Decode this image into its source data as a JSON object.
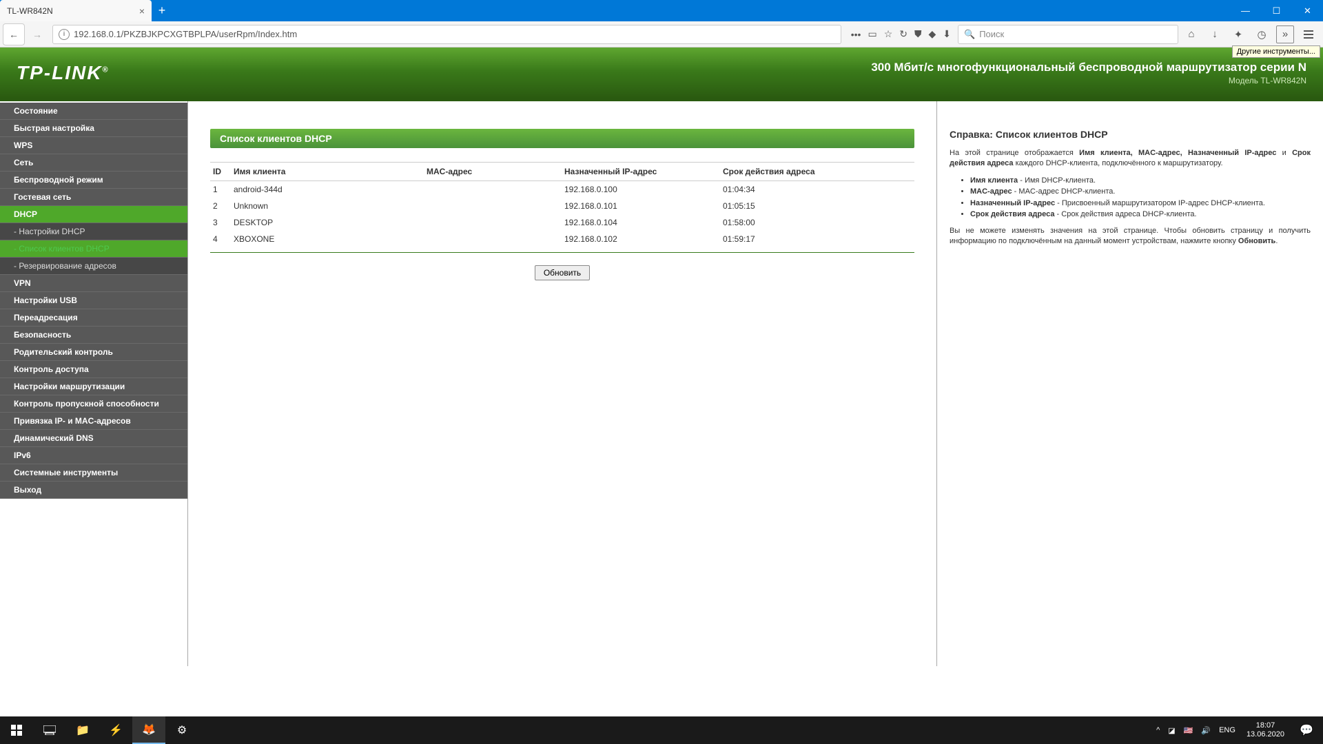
{
  "browser": {
    "tab_title": "TL-WR842N",
    "url": "192.168.0.1/PKZBJKPCXGTBPLPA/userRpm/Index.htm",
    "search_placeholder": "Поиск",
    "tooltip": "Другие инструменты..."
  },
  "router_header": {
    "logo": "TP-LINK",
    "title": "300 Мбит/с многофункциональный беспроводной маршрутизатор серии N",
    "model": "Модель TL-WR842N"
  },
  "sidebar": {
    "items": [
      {
        "label": "Состояние",
        "type": "main"
      },
      {
        "label": "Быстрая настройка",
        "type": "main"
      },
      {
        "label": "WPS",
        "type": "main"
      },
      {
        "label": "Сеть",
        "type": "main"
      },
      {
        "label": "Беспроводной режим",
        "type": "main"
      },
      {
        "label": "Гостевая сеть",
        "type": "main"
      },
      {
        "label": "DHCP",
        "type": "main",
        "active": true
      },
      {
        "label": "- Настройки DHCP",
        "type": "sub"
      },
      {
        "label": "- Список клиентов DHCP",
        "type": "sub",
        "active": true
      },
      {
        "label": "- Резервирование адресов",
        "type": "sub"
      },
      {
        "label": "VPN",
        "type": "main"
      },
      {
        "label": "Настройки USB",
        "type": "main"
      },
      {
        "label": "Переадресация",
        "type": "main"
      },
      {
        "label": "Безопасность",
        "type": "main"
      },
      {
        "label": "Родительский контроль",
        "type": "main"
      },
      {
        "label": "Контроль доступа",
        "type": "main"
      },
      {
        "label": "Настройки маршрутизации",
        "type": "main"
      },
      {
        "label": "Контроль пропускной способности",
        "type": "main"
      },
      {
        "label": "Привязка IP- и MAC-адресов",
        "type": "main"
      },
      {
        "label": "Динамический DNS",
        "type": "main"
      },
      {
        "label": "IPv6",
        "type": "main"
      },
      {
        "label": "Системные инструменты",
        "type": "main"
      },
      {
        "label": "Выход",
        "type": "main"
      }
    ]
  },
  "content": {
    "panel_title": "Список клиентов DHCP",
    "columns": {
      "id": "ID",
      "name": "Имя клиента",
      "mac": "MAC-адрес",
      "ip": "Назначенный IP-адрес",
      "lease": "Срок действия адреса"
    },
    "rows": [
      {
        "id": "1",
        "name": "android-344d",
        "mac": "",
        "ip": "192.168.0.100",
        "lease": "01:04:34"
      },
      {
        "id": "2",
        "name": "Unknown",
        "mac": "",
        "ip": "192.168.0.101",
        "lease": "01:05:15"
      },
      {
        "id": "3",
        "name": "DESKTOP",
        "mac": "",
        "ip": "192.168.0.104",
        "lease": "01:58:00"
      },
      {
        "id": "4",
        "name": "XBOXONE",
        "mac": "",
        "ip": "192.168.0.102",
        "lease": "01:59:17"
      }
    ],
    "refresh_label": "Обновить"
  },
  "help": {
    "title": "Справка: Список клиентов DHCP",
    "intro_1": "На этой странице отображается ",
    "intro_bold": "Имя клиента, MAC-адрес, Назначенный IP-адрес",
    "intro_2": " и ",
    "intro_bold2": "Срок действия адреса",
    "intro_3": " каждого DHCP-клиента, подключённого к маршрутизатору.",
    "li1_b": "Имя клиента",
    "li1_t": " - Имя DHCP-клиента.",
    "li2_b": "MAC-адрес",
    "li2_t": " - MAC-адрес DHCP-клиента.",
    "li3_b": "Назначенный IP-адрес",
    "li3_t": " - Присвоенный маршрутизатором IP-адрес DHCP-клиента.",
    "li4_b": "Срок действия адреса",
    "li4_t": " - Срок действия адреса DHCP-клиента.",
    "footer_1": "Вы не можете изменять значения на этой странице. Чтобы обновить страницу и получить информацию по подключённым на данный момент устройствам, нажмите кнопку ",
    "footer_b": "Обновить",
    "footer_2": "."
  },
  "taskbar": {
    "lang": "ENG",
    "time": "18:07",
    "date": "13.06.2020"
  }
}
